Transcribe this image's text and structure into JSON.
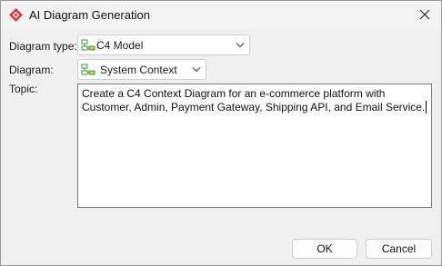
{
  "window": {
    "title": "AI Diagram Generation",
    "app_icon": "diamond-logo-icon",
    "close_icon": "close-icon"
  },
  "form": {
    "diagram_type_label": "Diagram type:",
    "diagram_type_value": "C4 Model",
    "diagram_label": "Diagram:",
    "diagram_value": "System Context",
    "topic_label": "Topic:",
    "topic_value": "Create a C4 Context Diagram for an e-commerce platform with Customer, Admin, Payment Gateway, Shipping API, and Email Service."
  },
  "buttons": {
    "ok": "OK",
    "cancel": "Cancel"
  },
  "colors": {
    "accent_icon": "#d9363e",
    "c4_icon_green": "#3a9d3a",
    "c4_icon_yellow": "#f2c14e"
  }
}
